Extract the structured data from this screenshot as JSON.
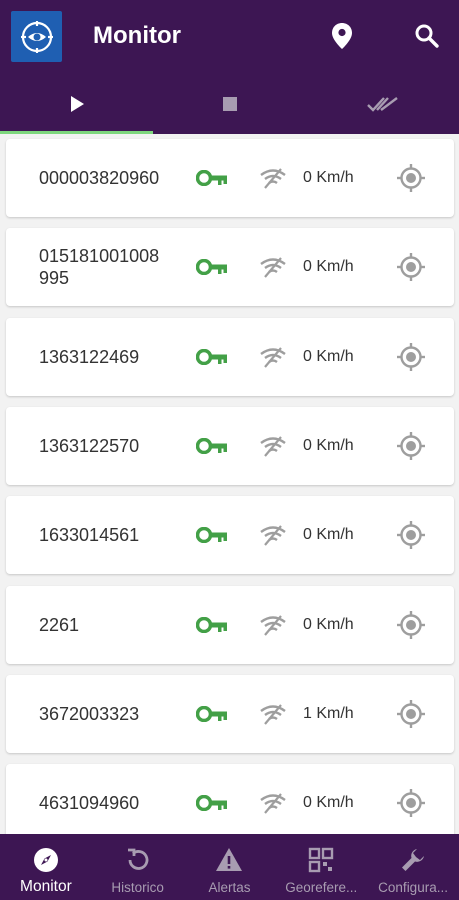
{
  "app": {
    "title": "Monitor",
    "accent_color": "#3d1653",
    "key_color": "#43a047"
  },
  "header": {
    "icons": [
      "location-pin-icon",
      "search-icon"
    ]
  },
  "tabs": [
    {
      "icon": "play-icon",
      "active": true
    },
    {
      "icon": "stop-icon",
      "active": false
    },
    {
      "icon": "double-check-icon",
      "active": false
    }
  ],
  "vehicles": [
    {
      "id": "000003820960",
      "speed": "0 Km/h"
    },
    {
      "id": "015181001008995",
      "speed": "0 Km/h"
    },
    {
      "id": "1363122469",
      "speed": "0 Km/h"
    },
    {
      "id": "1363122570",
      "speed": "0 Km/h"
    },
    {
      "id": "1633014561",
      "speed": "0 Km/h"
    },
    {
      "id": "2261",
      "speed": "0 Km/h"
    },
    {
      "id": "3672003323",
      "speed": "1 Km/h"
    },
    {
      "id": "4631094960",
      "speed": "0 Km/h"
    }
  ],
  "bottom_nav": [
    {
      "label": "Monitor",
      "icon": "compass-icon",
      "active": true
    },
    {
      "label": "Historico",
      "icon": "history-icon",
      "active": false
    },
    {
      "label": "Alertas",
      "icon": "warning-icon",
      "active": false
    },
    {
      "label": "Georefere...",
      "icon": "grid-icon",
      "active": false
    },
    {
      "label": "Configura...",
      "icon": "wrench-icon",
      "active": false
    }
  ]
}
